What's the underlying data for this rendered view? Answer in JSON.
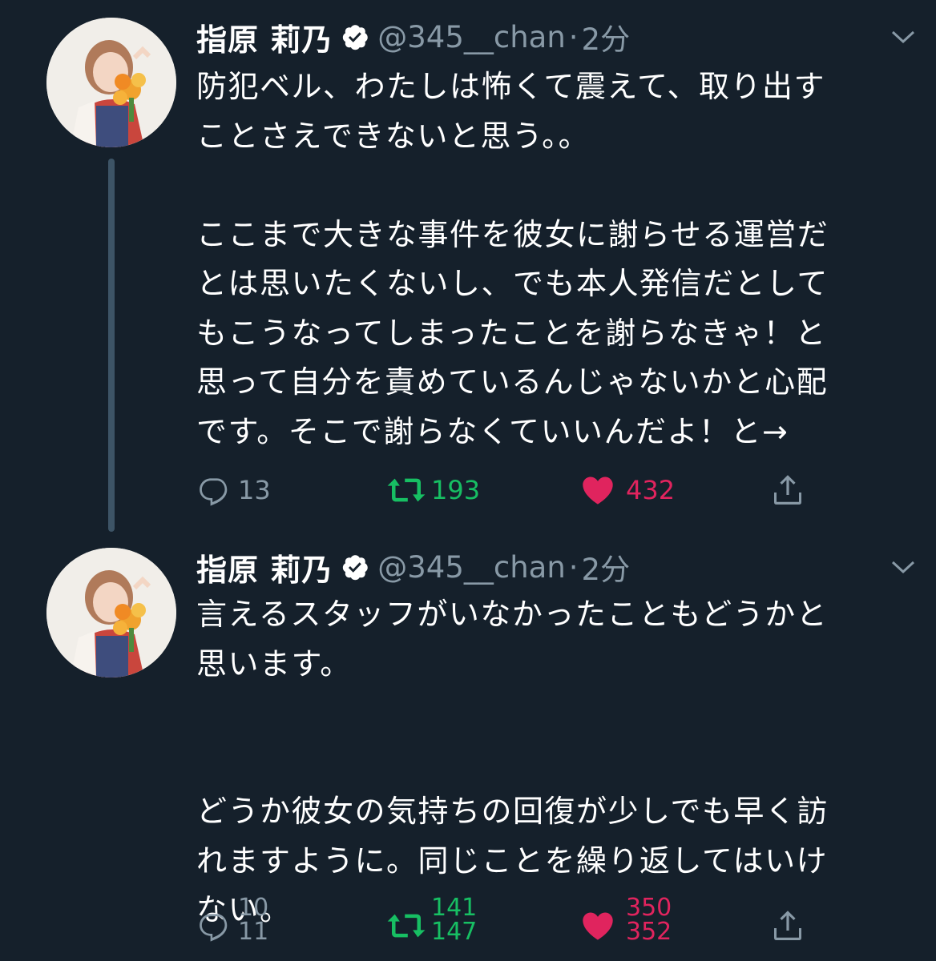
{
  "colors": {
    "background": "#15202b",
    "secondary_text": "#8899a6",
    "retweet": "#17bf63",
    "like": "#e0245e",
    "verified": "#ffffff"
  },
  "tweets": [
    {
      "name": "指原 莉乃",
      "handle": "@345__chan",
      "separator": "·",
      "time": "2分",
      "lines": [
        "防犯ベル、わたしは怖くて震えて、取り出す",
        "ことさえできないと思う。。",
        "",
        "ここまで大きな事件を彼女に謝らせる運営だ",
        "とは思いたくないし、でも本人発信だとして",
        "もこうなってしまったことを謝らなきゃ！と",
        "思って自分を責めているんじゃないかと心配",
        "です。そこで謝らなくていいんだよ！と→"
      ],
      "replies": "13",
      "retweets": "193",
      "likes": "432",
      "liked": true,
      "icons": {
        "reply": "reply-icon",
        "retweet": "retweet-icon",
        "like": "heart-icon",
        "share": "share-icon",
        "verified": "verified-badge-icon",
        "caret": "chevron-down-icon"
      }
    },
    {
      "name": "指原 莉乃",
      "handle": "@345__chan",
      "separator": "·",
      "time": "2分",
      "lines": [
        "言えるスタッフがいなかったこともどうかと",
        "思います。",
        "",
        "",
        "どうか彼女の気持ちの回復が少しでも早く訪",
        "れますように。同じことを繰り返してはいけ",
        "ない。"
      ],
      "replies_old": "10",
      "replies_new": "11",
      "retweets_old": "141",
      "retweets_new": "147",
      "likes_old": "350",
      "likes_new": "352",
      "liked": true
    }
  ]
}
